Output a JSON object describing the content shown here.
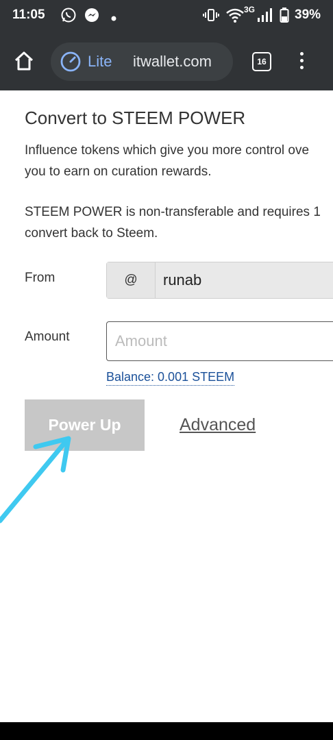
{
  "status_bar": {
    "time": "11:05",
    "notifications": [
      "whatsapp-icon",
      "messenger-icon",
      "dot-icon"
    ],
    "network": "3G",
    "battery": "39%"
  },
  "browser": {
    "lite_label": "Lite",
    "url": "itwallet.com",
    "tab_count": "16"
  },
  "form": {
    "title": "Convert to STEEM POWER",
    "description_lines": [
      "Influence tokens which give you more control ove",
      "you to earn on curation rewards."
    ],
    "note_lines": [
      "STEEM POWER is non-transferable and requires 1",
      "convert back to Steem."
    ],
    "from_label": "From",
    "at_symbol": "@",
    "from_value": "runab",
    "amount_label": "Amount",
    "amount_placeholder": "Amount",
    "amount_value": "",
    "balance_text": "Balance: 0.001 STEEM",
    "power_up_label": "Power Up",
    "advanced_label": "Advanced"
  },
  "colors": {
    "chrome_bg": "#303336",
    "link_blue": "#1a5099",
    "annotation_arrow": "#3fc9f0",
    "button_disabled": "#c7c7c7"
  }
}
